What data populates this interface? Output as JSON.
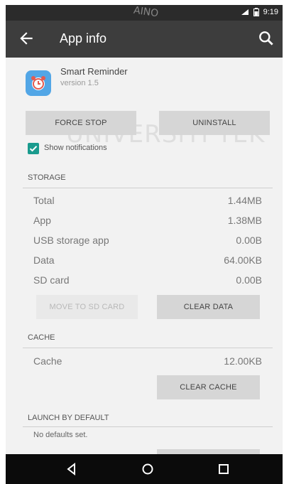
{
  "status_bar": {
    "time": "9:19"
  },
  "app_bar": {
    "title": "App info"
  },
  "app": {
    "name": "Smart Reminder",
    "version": "version 1.5"
  },
  "buttons": {
    "force_stop": "FORCE STOP",
    "uninstall": "UNINSTALL",
    "move_to_sd": "MOVE TO SD CARD",
    "clear_data": "CLEAR DATA",
    "clear_cache": "CLEAR CACHE"
  },
  "notifications": {
    "label": "Show notifications",
    "checked": true
  },
  "storage": {
    "header": "STORAGE",
    "rows": [
      {
        "label": "Total",
        "value": "1.44MB"
      },
      {
        "label": "App",
        "value": "1.38MB"
      },
      {
        "label": "USB storage app",
        "value": "0.00B"
      },
      {
        "label": "Data",
        "value": "64.00KB"
      },
      {
        "label": "SD card",
        "value": "0.00B"
      }
    ]
  },
  "cache": {
    "header": "CACHE",
    "row": {
      "label": "Cache",
      "value": "12.00KB"
    }
  },
  "launch": {
    "header": "LAUNCH BY DEFAULT",
    "text": "No defaults set."
  },
  "watermark": {
    "text": "UNIVERSITI TEK",
    "fragment": "AINO"
  },
  "colors": {
    "app_bar": "#3d3d3d",
    "accent": "#1a9b8e",
    "icon_bg": "#52a6e6"
  }
}
